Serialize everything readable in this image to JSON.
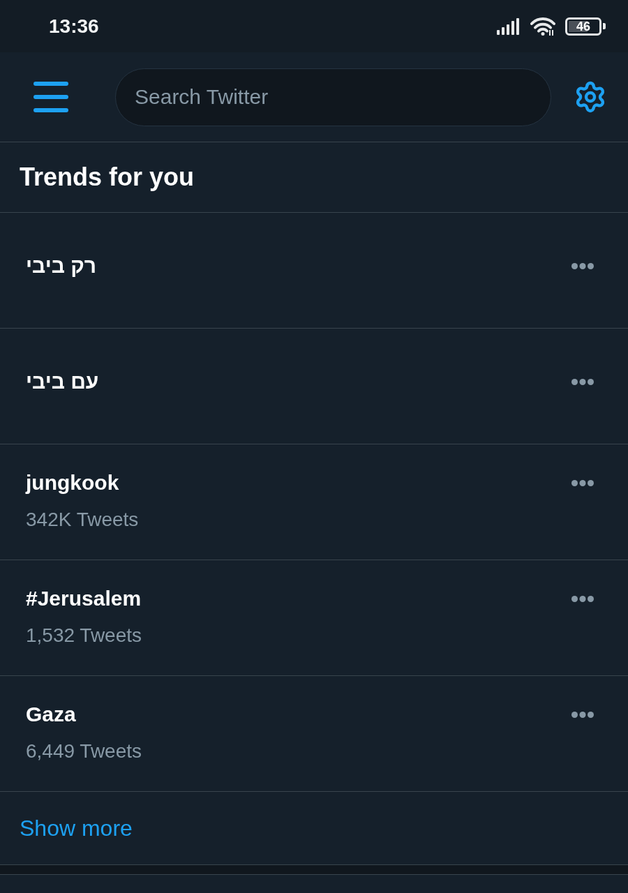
{
  "status_bar": {
    "time": "13:36",
    "battery": "46"
  },
  "header": {
    "search": {
      "placeholder": "Search Twitter"
    }
  },
  "section": {
    "title": "Trends for you"
  },
  "trends": [
    {
      "name": "רק ביבי"
    },
    {
      "name": "עם ביבי"
    },
    {
      "name": "jungkook",
      "tweets": "342K Tweets"
    },
    {
      "name": "#Jerusalem",
      "tweets": "1,532 Tweets"
    },
    {
      "name": "Gaza",
      "tweets": "6,449 Tweets"
    }
  ],
  "show_more": "Show more"
}
